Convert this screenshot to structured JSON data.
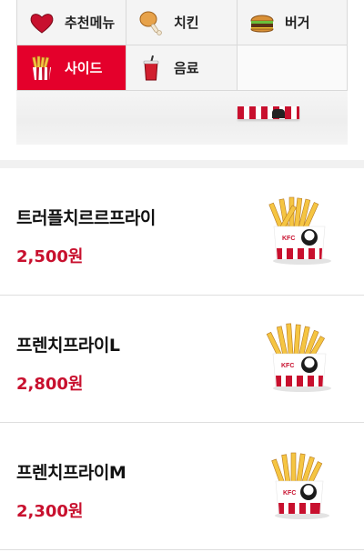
{
  "categories": [
    {
      "label": "추천메뉴",
      "icon": "heart-icon",
      "active": false
    },
    {
      "label": "치킨",
      "icon": "chicken-leg-icon",
      "active": false
    },
    {
      "label": "버거",
      "icon": "burger-icon",
      "active": false
    },
    {
      "label": "사이드",
      "icon": "fries-icon",
      "active": true
    },
    {
      "label": "음료",
      "icon": "drink-icon",
      "active": false
    }
  ],
  "products": [
    {
      "name": "트러플치르르프라이",
      "price": "2,500원",
      "image": "fries-icon"
    },
    {
      "name": "프렌치프라이L",
      "price": "2,800원",
      "image": "fries-icon"
    },
    {
      "name": "프렌치프라이M",
      "price": "2,300원",
      "image": "fries-icon"
    }
  ],
  "colors": {
    "accent": "#e4002b",
    "price": "#c8102e"
  }
}
